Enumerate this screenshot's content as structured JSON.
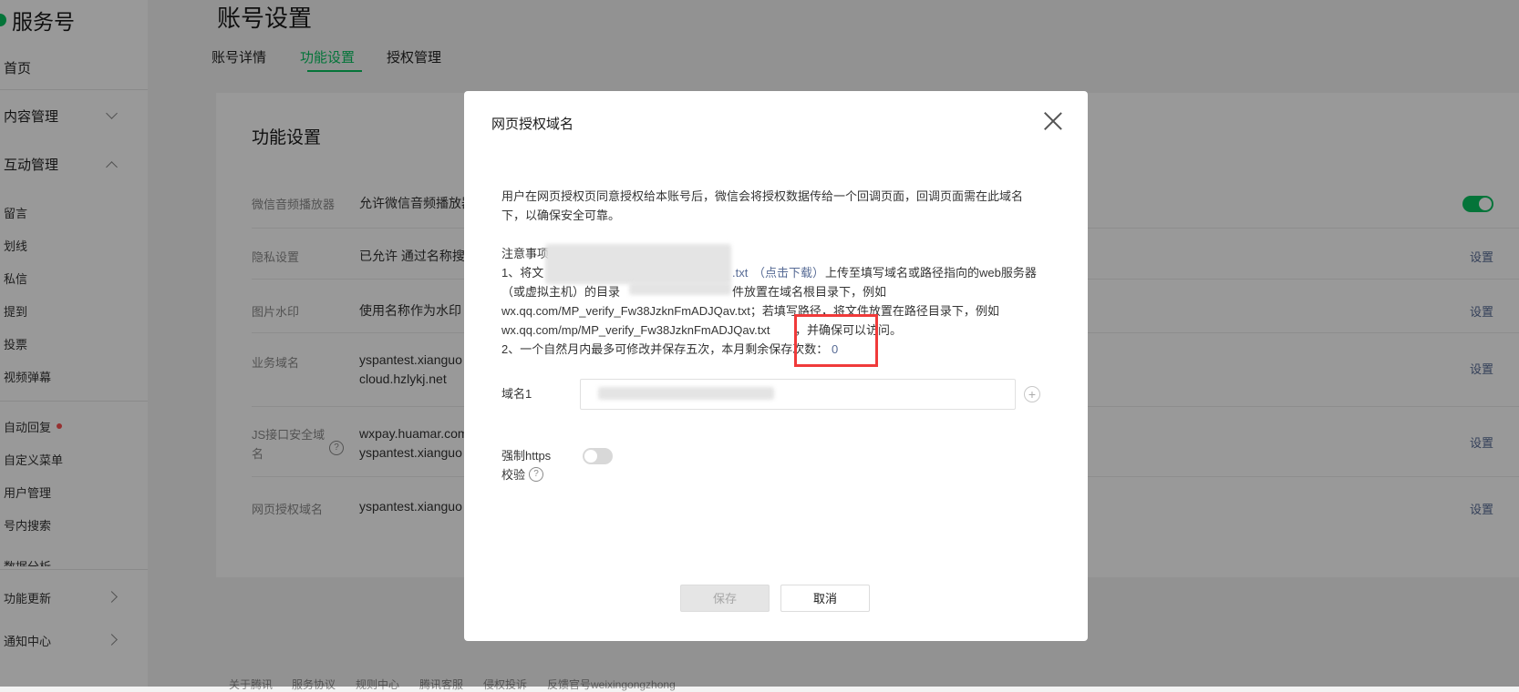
{
  "sidebar": {
    "brand": "服务号",
    "home": "首页",
    "content_mgmt": "内容管理",
    "interaction_mgmt": "互动管理",
    "interaction_items": [
      "留言",
      "划线",
      "私信",
      "提到",
      "投票",
      "视频弹幕"
    ],
    "auto_reply": "自动回复",
    "custom_menu": "自定义菜单",
    "user_mgmt": "用户管理",
    "in_account_search": "号内搜索",
    "data_analysis": "数据分析",
    "feature_update": "功能更新",
    "notification_center": "通知中心"
  },
  "main": {
    "page_title": "账号设置",
    "tabs": [
      "账号详情",
      "功能设置",
      "授权管理"
    ],
    "active_tab": "功能设置",
    "card_title": "功能设置",
    "rows": [
      {
        "label": "微信音频播放器",
        "value": "允许微信音频播放器"
      },
      {
        "label": "隐私设置",
        "value": "已允许 通过名称搜索",
        "action": "设置"
      },
      {
        "label": "图片水印",
        "value": "使用名称作为水印",
        "action": "设置"
      },
      {
        "label": "业务域名",
        "value": "yspantest.xianguo",
        "value2": "cloud.hzlykj.net",
        "action": "设置"
      },
      {
        "label": "JS接口安全域",
        "label2": "名",
        "value": "wxpay.huamar.com",
        "value2": "yspantest.xianguo",
        "action": "设置"
      },
      {
        "label": "网页授权域名",
        "value": "yspantest.xianguo",
        "action": "设置"
      }
    ],
    "footer_links": [
      "关于腾讯",
      "服务协议",
      "规则中心",
      "腾讯客服",
      "侵权投诉",
      "反馈官号weixingongzhong"
    ]
  },
  "dialog": {
    "title": "网页授权域名",
    "intro_line1": "用户在网页授权页同意授权给本账号后，微信会将授权数据传给一个回调页面，回调页面需在此域名",
    "intro_line2": "下，以确保安全可靠。",
    "notes_heading": "注意事项：",
    "note1_prefix": "1、将文",
    "note1_file_suffix": ".txt",
    "note1_download": "（点击下载）",
    "note1_rest": "上传至填写域名或路径指向的web服务器",
    "note1_line2_prefix": "（或虚拟主机）的目录",
    "note1_line2_suffix": "件放置在域名根目录下，例如",
    "note1_line3": "wx.qq.com/MP_verify_Fw38JzknFmADJQav.txt；若填写路径，将文件放置在路径目录下，例如",
    "note1_line4_a": "wx.qq.com/mp/MP_verify_Fw38JzknFmADJQav.txt",
    "note1_line4_b": "，并确保可以访问。",
    "note2_text": "2、一个自然月内最多可修改并保存五次，本月剩余保存次数：",
    "note2_count": "0",
    "domain_label": "域名1",
    "https_label_line1": "强制https",
    "https_label_line2": "校验",
    "save_label": "保存",
    "cancel_label": "取消"
  },
  "colors": {
    "accent": "#07c160",
    "link": "#576b95",
    "highlight": "#f03a3a"
  }
}
